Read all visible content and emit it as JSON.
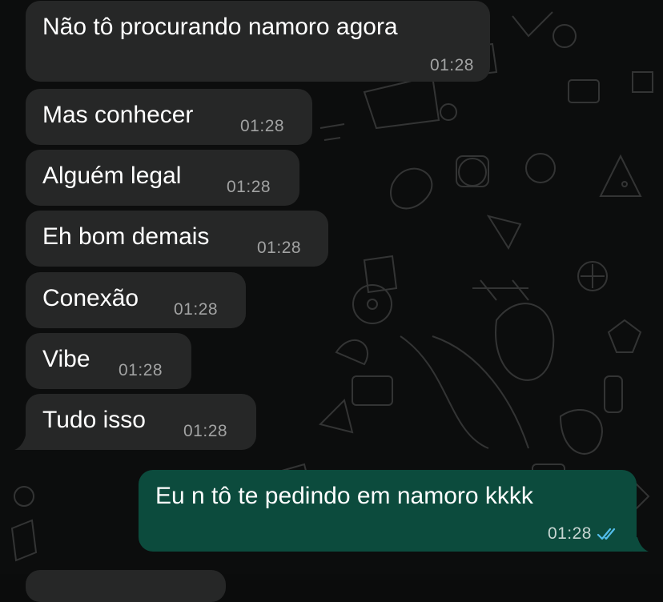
{
  "chat": {
    "messages": [
      {
        "direction": "incoming",
        "text": "Não tô procurando namoro agora",
        "time": "01:28"
      },
      {
        "direction": "incoming",
        "text": "Mas conhecer",
        "time": "01:28"
      },
      {
        "direction": "incoming",
        "text": "Alguém legal",
        "time": "01:28"
      },
      {
        "direction": "incoming",
        "text": "Eh bom demais",
        "time": "01:28"
      },
      {
        "direction": "incoming",
        "text": "Conexão",
        "time": "01:28"
      },
      {
        "direction": "incoming",
        "text": "Vibe",
        "time": "01:28"
      },
      {
        "direction": "incoming",
        "text": "Tudo isso",
        "time": "01:28"
      },
      {
        "direction": "outgoing",
        "text": "Eu n tô te pedindo em namoro kkkk",
        "time": "01:28",
        "status": "read"
      }
    ]
  },
  "colors": {
    "incoming_bubble": "#262727",
    "outgoing_bubble": "#0c4b3d",
    "background": "#0c0d0d",
    "read_ticks": "#53bdeb"
  },
  "icons": {
    "read_receipt": "double-check-icon",
    "wallpaper": "doodle-pattern"
  }
}
